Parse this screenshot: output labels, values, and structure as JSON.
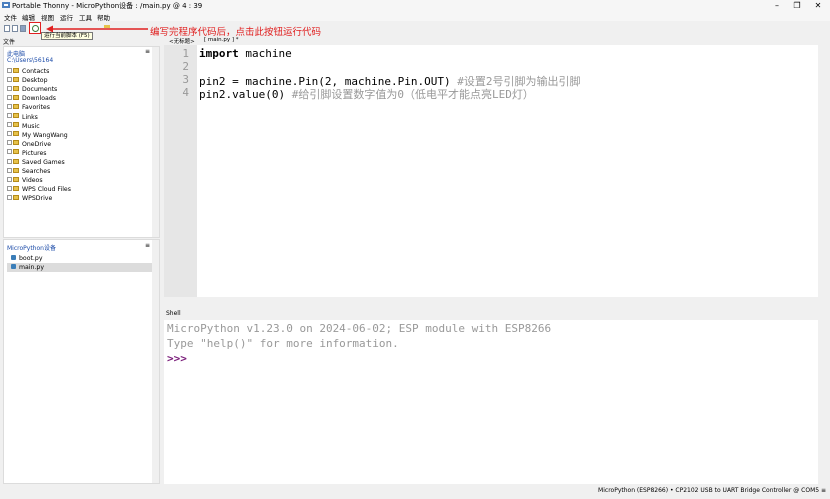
{
  "window": {
    "title": "Portable Thonny  -  MicroPython设备 : /main.py  @  4 : 39"
  },
  "menu": [
    "文件",
    "编辑",
    "视图",
    "运行",
    "工具",
    "帮助"
  ],
  "toolbar": {
    "tooltip": "运行当前脚本 (F5)",
    "annotation": "编写完程序代码后，点击此按钮运行代码",
    "annotation_color": "#e02020"
  },
  "files_panel": {
    "header": "文件",
    "title": "此电脑",
    "path": "C:\\Users\\56164",
    "items": [
      "Contacts",
      "Desktop",
      "Documents",
      "Downloads",
      "Favorites",
      "Links",
      "Music",
      "My WangWang",
      "OneDrive",
      "Pictures",
      "Saved Games",
      "Searches",
      "Videos",
      "WPS Cloud Files",
      "WPSDrive"
    ]
  },
  "device_panel": {
    "title": "MicroPython设备",
    "files": [
      {
        "name": "boot.py",
        "selected": false
      },
      {
        "name": "main.py",
        "selected": true
      }
    ]
  },
  "editor": {
    "tabs": [
      "<无标题>",
      "[ main.py ] *"
    ],
    "lines": [
      {
        "n": "1",
        "kw": "import",
        "rest": " machine",
        "comment": ""
      },
      {
        "n": "2",
        "kw": "",
        "rest": "",
        "comment": ""
      },
      {
        "n": "3",
        "kw": "",
        "rest": "pin2 = machine.Pin(2, machine.Pin.OUT) ",
        "comment": "#设置2号引脚为输出引脚"
      },
      {
        "n": "4",
        "kw": "",
        "rest": "pin2.value(0) ",
        "comment": "#给引脚设置数字值为0（低电平才能点亮LED灯）"
      }
    ]
  },
  "shell": {
    "tab": "Shell",
    "lines": [
      "MicroPython v1.23.0 on 2024-06-02; ESP module with ESP8266",
      "Type \"help()\" for more information."
    ],
    "prompt": ">>>"
  },
  "status": "MicroPython (ESP8266)  •  CP2102 USB to UART Bridge Controller @ COM5  ≡"
}
